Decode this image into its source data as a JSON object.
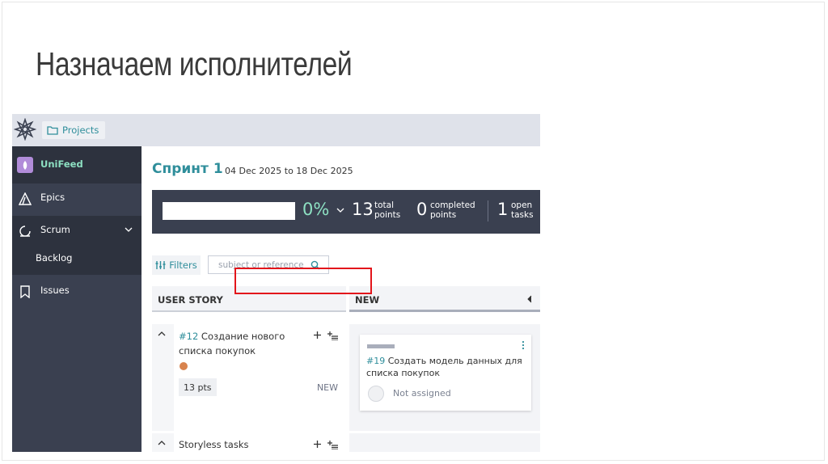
{
  "slide": {
    "title": "Назначаем исполнителей"
  },
  "topbar": {
    "projects_label": "Projects"
  },
  "sidebar": {
    "project_name": "UniFeed",
    "items": [
      {
        "label": "Epics",
        "icon": "epics-icon"
      },
      {
        "label": "Scrum",
        "icon": "scrum-icon"
      },
      {
        "label": "Backlog"
      },
      {
        "label": "Issues",
        "icon": "bookmark-icon"
      }
    ]
  },
  "sprint": {
    "title": "Спринт 1",
    "dates": "04 Dec 2025 to 18 Dec 2025",
    "progress_percent": "0%",
    "progress_fraction": 0,
    "total_points": "13",
    "total_points_label_1": "total",
    "total_points_label_2": "points",
    "completed_points": "0",
    "completed_label_1": "completed",
    "completed_label_2": "points",
    "open_tasks": "1",
    "open_label_1": "open",
    "open_label_2": "tasks"
  },
  "filters": {
    "label": "Filters",
    "search_placeholder": "subject or reference"
  },
  "columns": {
    "user_story": "USER STORY",
    "new": "NEW"
  },
  "story": {
    "ref": "#12",
    "title": " Создание нового списка покупок",
    "points": "13 pts",
    "status": "NEW",
    "dot_color": "#d8834e"
  },
  "task": {
    "ref": "#19",
    "title": " Создать модель данных для списка покупок",
    "assignee": "Not assigned"
  },
  "storyless": {
    "label": "Storyless tasks"
  },
  "colors": {
    "accent": "#2f8e9b",
    "sidebar": "#3a4050",
    "highlight": "#e3151b",
    "mint": "#8de0c2"
  }
}
